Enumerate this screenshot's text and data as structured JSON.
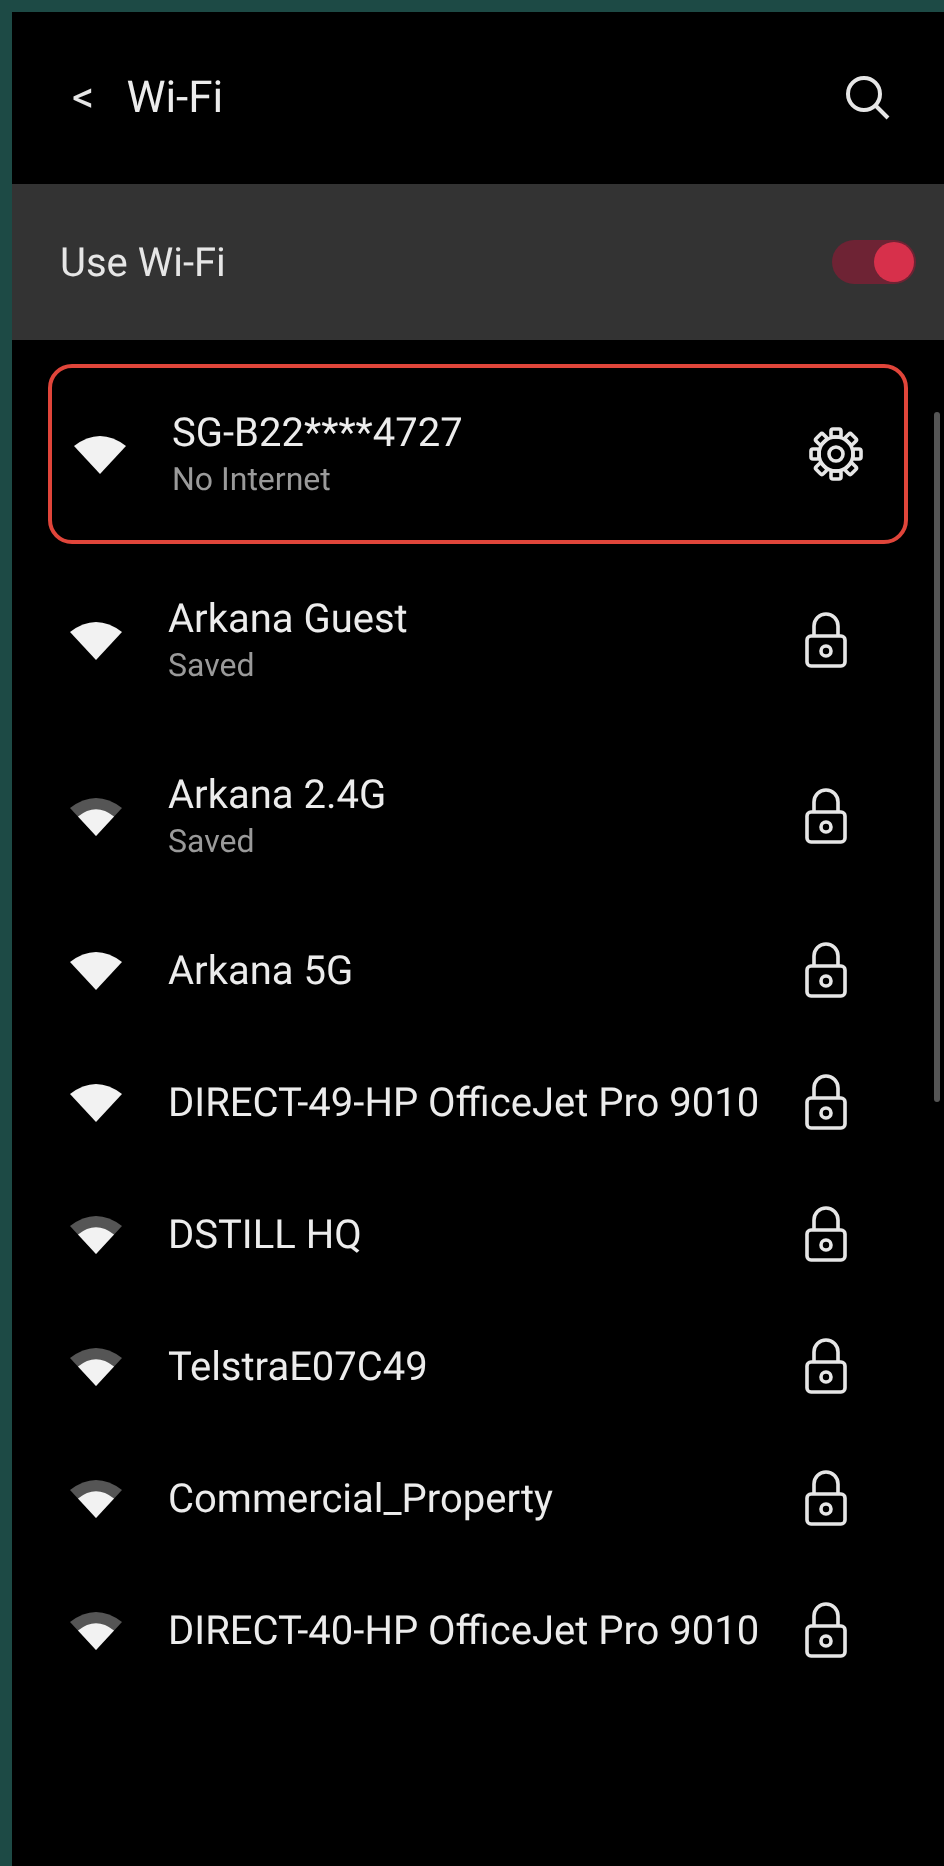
{
  "header": {
    "back": "<",
    "title": "Wi-Fi"
  },
  "toggle_row": {
    "label": "Use Wi-Fi",
    "on": true
  },
  "networks": [
    {
      "name": "SG-B22****4727",
      "status": "No Internet",
      "weak_signal": false,
      "kind": "connected",
      "highlighted": true
    },
    {
      "name": "Arkana Guest",
      "status": "Saved",
      "weak_signal": false,
      "kind": "secured",
      "highlighted": false
    },
    {
      "name": "Arkana 2.4G",
      "status": "Saved",
      "weak_signal": true,
      "kind": "secured",
      "highlighted": false
    },
    {
      "name": "Arkana 5G",
      "weak_signal": false,
      "kind": "secured",
      "highlighted": false
    },
    {
      "name": "DIRECT-49-HP OfficeJet Pro 9010",
      "weak_signal": false,
      "kind": "secured",
      "highlighted": false
    },
    {
      "name": "DSTILL HQ",
      "weak_signal": true,
      "kind": "secured",
      "highlighted": false
    },
    {
      "name": "TelstraE07C49",
      "weak_signal": true,
      "kind": "secured",
      "highlighted": false
    },
    {
      "name": "Commercial_Property",
      "weak_signal": true,
      "kind": "secured",
      "highlighted": false
    },
    {
      "name": "DIRECT-40-HP OfficeJet Pro 9010",
      "weak_signal": true,
      "kind": "secured",
      "highlighted": false
    }
  ]
}
